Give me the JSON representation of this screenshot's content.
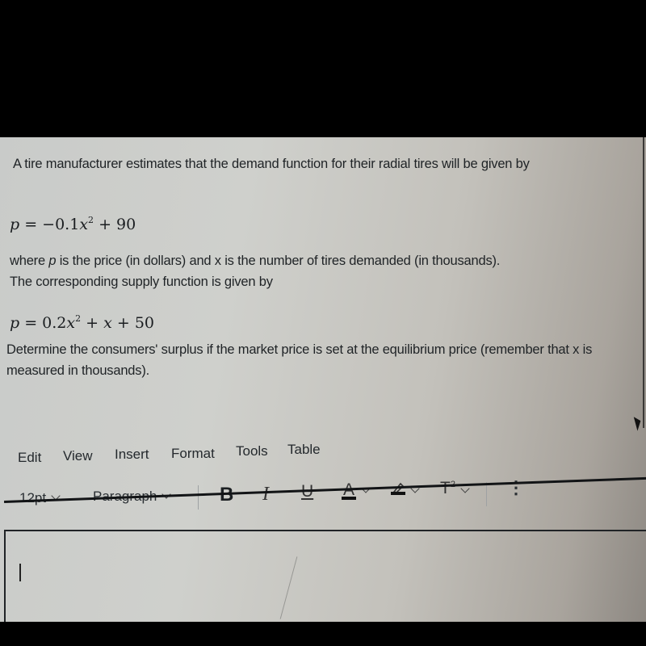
{
  "question": {
    "intro": "A tire manufacturer estimates that the demand function for their radial tires will be given by",
    "demand_function": {
      "lhs": "p",
      "rhs_parts": [
        "−0.1",
        "x",
        "2",
        " + 90"
      ]
    },
    "explanation_parts": {
      "before_p": "where ",
      "p_var": "p",
      "after_p": " is the price (in dollars) and x is the number of tires demanded (in thousands).",
      "line2": "The corresponding supply function is given by"
    },
    "supply_function": {
      "lhs": "p",
      "rhs_parts": [
        "0.2",
        "x",
        "2",
        " + ",
        "x",
        " + 50"
      ]
    },
    "task": "Determine the consumers' surplus if the market price is set at the equilibrium price (remember that x is measured in thousands)."
  },
  "editor": {
    "menu": [
      "Edit",
      "View",
      "Insert",
      "Format",
      "Tools",
      "Table"
    ],
    "toolbar": {
      "font_size": "12pt",
      "block_format": "Paragraph",
      "bold_label": "B",
      "italic_label": "I",
      "underline_label": "U",
      "font_color_label": "A",
      "highlight_icon": "highlighter-icon",
      "superscript_label": "T",
      "superscript_mark": "2",
      "more_icon": "⋮"
    },
    "content": ""
  }
}
